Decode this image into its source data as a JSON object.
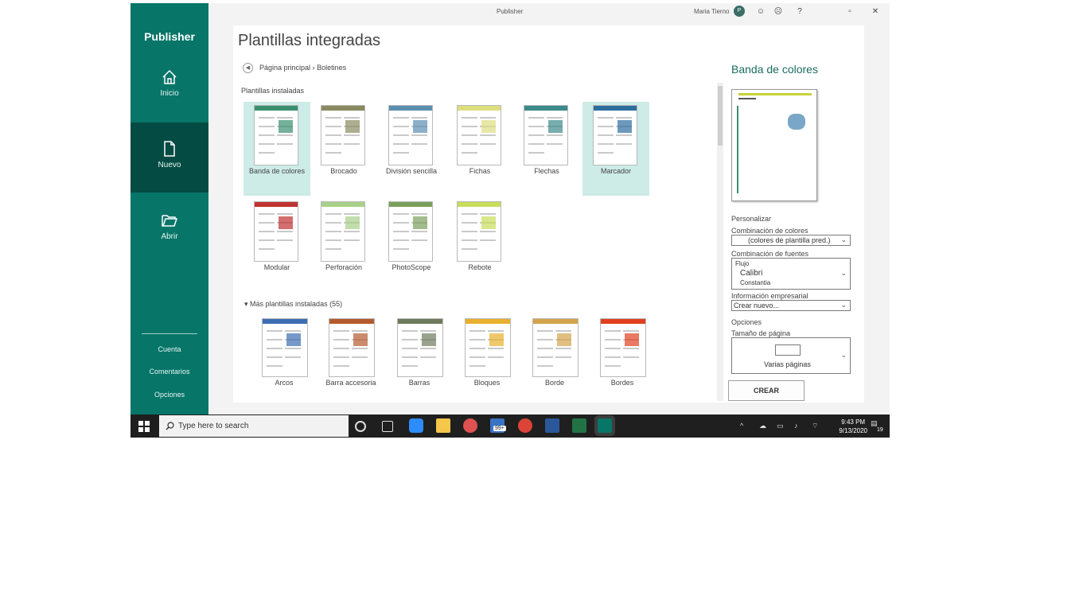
{
  "window": {
    "title": "Publisher",
    "user": "Maria Tierno",
    "avatar_initials": "P",
    "controls": [
      "☺",
      "☹",
      "?",
      "▫",
      "✕"
    ]
  },
  "sidebar": {
    "brand": "Publisher",
    "items": [
      {
        "label": "Inicio",
        "icon": "home-icon"
      },
      {
        "label": "Nuevo",
        "icon": "new-document-icon"
      },
      {
        "label": "Abrir",
        "icon": "open-folder-icon"
      }
    ],
    "footer": [
      "Cuenta",
      "Comentarios",
      "Opciones"
    ]
  },
  "main": {
    "title": "Plantillas integradas",
    "breadcrumb": {
      "back_glyph": "◀",
      "home": "Página principal",
      "separator": "›",
      "current": "Boletines"
    },
    "installed_heading": "Plantillas instaladas",
    "installed": [
      {
        "label": "Banda de colores",
        "accent": "#3a8f6f",
        "selected": true
      },
      {
        "label": "Brocado",
        "accent": "#8a8a62",
        "selected": false
      },
      {
        "label": "División sencilla",
        "accent": "#5b8fb0",
        "selected": false
      },
      {
        "label": "Fichas",
        "accent": "#dede80",
        "selected": false
      },
      {
        "label": "Flechas",
        "accent": "#3d8a8a",
        "selected": false
      },
      {
        "label": "Marcador",
        "accent": "#2d6e9e",
        "selected": true
      },
      {
        "label": "Modular",
        "accent": "#c03232",
        "selected": false
      },
      {
        "label": "Perforación",
        "accent": "#a8d089",
        "selected": false
      },
      {
        "label": "PhotoScope",
        "accent": "#7aa05c",
        "selected": false
      },
      {
        "label": "Rebote",
        "accent": "#c8dd5a",
        "selected": false
      }
    ],
    "more_heading": "▾ Más plantillas instaladas (55)",
    "more": [
      {
        "label": "Arcos",
        "accent": "#3d6db3"
      },
      {
        "label": "Barra accesoria",
        "accent": "#b45b2d"
      },
      {
        "label": "Barras",
        "accent": "#6e7b5c"
      },
      {
        "label": "Bloques",
        "accent": "#e8b02c"
      },
      {
        "label": "Borde",
        "accent": "#d3a44c"
      },
      {
        "label": "Bordes",
        "accent": "#e04020"
      }
    ]
  },
  "detail": {
    "title": "Banda de colores",
    "personalize": "Personalizar",
    "color_scheme_label": "Combinación de colores",
    "color_scheme_value": "(colores de plantilla pred.)",
    "font_scheme_label": "Combinación de fuentes",
    "font_scheme_lines": [
      "Flujo",
      "Calibri",
      "Constantia"
    ],
    "business_info_label": "Información empresarial",
    "business_info_value": "Crear nuevo...",
    "options": "Opciones",
    "page_size_label": "Tamaño de página",
    "page_size_value": "Varias páginas",
    "create": "CREAR"
  },
  "taskbar": {
    "search_placeholder": "Type here to search",
    "time": "9:43 PM",
    "date": "9/13/2020",
    "badge": "99+",
    "notif": "19"
  }
}
